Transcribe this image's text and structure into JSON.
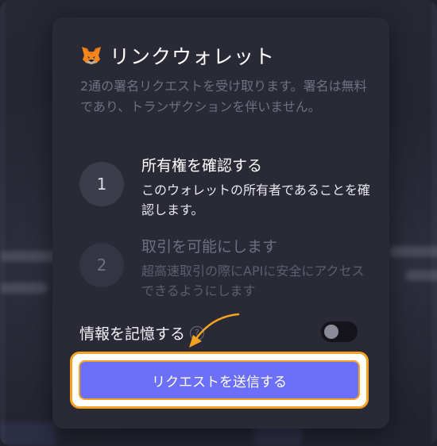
{
  "modal": {
    "title": "リンクウォレット",
    "subtitle": "2通の署名リクエストを受け取ります。署名は無料であり、トランザクションを伴いません。",
    "steps": [
      {
        "number": "1",
        "title": "所有権を確認する",
        "description": "このウォレットの所有者であることを確認します。"
      },
      {
        "number": "2",
        "title": "取引を可能にします",
        "description": "超高速取引の際にAPIに安全にアクセスできるようにします"
      }
    ],
    "remember": {
      "label": "情報を記憶する",
      "help": "?",
      "toggle_on": false
    },
    "submit_label": "リクエストを送信する"
  },
  "colors": {
    "accent": "#6c6ff7",
    "highlight": "#f5a223",
    "modal_bg": "#2a2a37"
  },
  "icons": [
    "metamask-fox-icon",
    "help-icon",
    "annotation-arrow-icon"
  ]
}
